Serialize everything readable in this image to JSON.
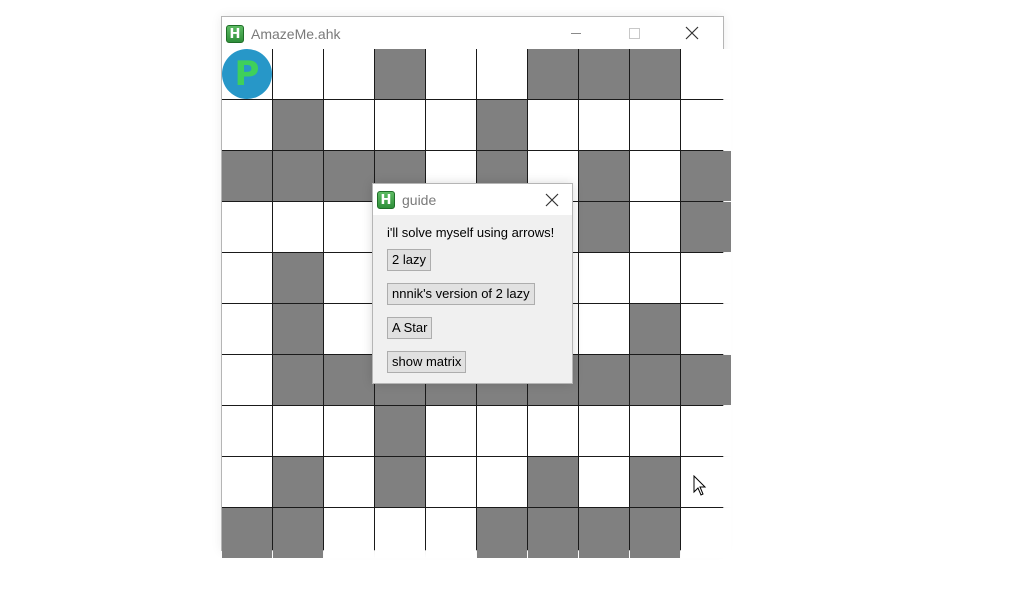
{
  "main_window": {
    "title": "AmazeMe.ahk",
    "app_icon_glyph": "H",
    "controls": [
      "minimize-icon",
      "maximize-icon",
      "close-icon"
    ]
  },
  "maze": {
    "rows": 10,
    "cols": 10,
    "cells": [
      [
        0,
        0,
        0,
        1,
        0,
        0,
        1,
        1,
        1,
        0
      ],
      [
        0,
        1,
        0,
        0,
        0,
        1,
        0,
        0,
        0,
        0
      ],
      [
        1,
        1,
        1,
        1,
        0,
        1,
        0,
        1,
        0,
        1
      ],
      [
        0,
        0,
        0,
        0,
        0,
        0,
        0,
        1,
        0,
        1
      ],
      [
        0,
        1,
        0,
        0,
        0,
        0,
        0,
        0,
        0,
        0
      ],
      [
        0,
        1,
        0,
        0,
        0,
        0,
        0,
        0,
        1,
        0
      ],
      [
        0,
        1,
        1,
        1,
        1,
        1,
        1,
        1,
        1,
        1
      ],
      [
        0,
        0,
        0,
        1,
        0,
        0,
        0,
        0,
        0,
        0
      ],
      [
        0,
        1,
        0,
        1,
        0,
        0,
        1,
        0,
        1,
        0
      ],
      [
        1,
        1,
        0,
        0,
        0,
        1,
        1,
        1,
        1,
        0
      ]
    ],
    "player": {
      "row": 0,
      "col": 0,
      "label": "P"
    },
    "colors": {
      "wall": "#808080",
      "open": "#ffffff",
      "player": "#2797c8",
      "player_letter": "#3fd05a"
    }
  },
  "guide_dialog": {
    "title": "guide",
    "app_icon_glyph": "H",
    "prompt": "i'll solve myself using arrows!",
    "buttons": [
      "2 lazy",
      "nnnik's version of 2 lazy",
      "A Star",
      "show matrix"
    ]
  }
}
